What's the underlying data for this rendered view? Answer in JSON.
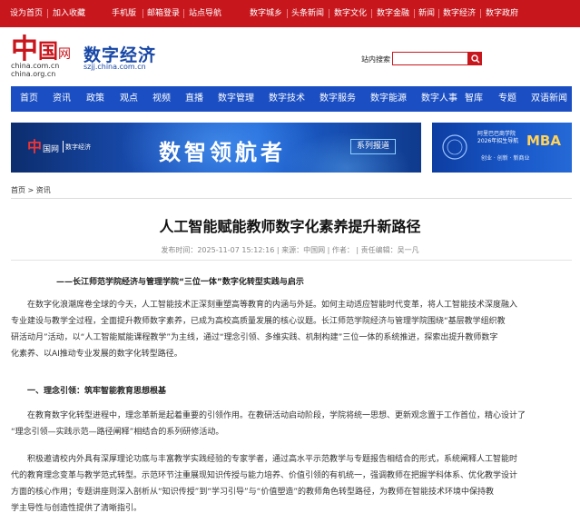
{
  "topbar": {
    "links": [
      "设为首页",
      "加入收藏",
      "手机版",
      "邮箱登录",
      "站点导航",
      "数字城乡",
      "头条新闻",
      "数字文化",
      "数字金融",
      "新闻",
      "数字经济",
      "数字政府"
    ]
  },
  "header": {
    "logo_text": "中国网",
    "logo_domain_1": "china.com.cn",
    "logo_domain_2": "china.org.cn",
    "channel_name": "数字经济",
    "channel_domain": "szjj.china.com.cn",
    "search_label": "站内搜索",
    "search_placeholder": ""
  },
  "nav": {
    "items": [
      "首页",
      "资讯",
      "政策",
      "观点",
      "视频",
      "直播",
      "数字管理",
      "数字技术",
      "数字服务",
      "数字能源",
      "数字人事",
      "智库",
      "专题",
      "双语新闻"
    ]
  },
  "banner_main": {
    "logo_text": "中国网 数字经济",
    "title": "数智领航者",
    "tag": "系列报道"
  },
  "banner_ad": {
    "line1": "阿里巴巴商学院",
    "line2": "2026年招生导航",
    "mba": "MBA",
    "line3": "创业 · 创新 · 新商业"
  },
  "breadcrumb": {
    "home": "首页",
    "sep": " > ",
    "current": "资讯"
  },
  "article": {
    "title": "人工智能赋能教师数字化素养提升新路径",
    "meta": "发布时间：2025-11-07 15:12:16 | 来源：中国网 | 作者： | 责任编辑：吴一凡",
    "subtitle": "——长江师范学院经济与管理学院“三位一体”数字化转型实践与启示",
    "para1_lines": [
      "在数字化浪潮席卷全球的今天，人工智能技术正深刻重塑高等教育的内涵与外延。如何主动适应智能时代变革，将人工智能技术深度融入",
      "专业建设与教学全过程，全面提升教师数字素养，已成为高校高质量发展的核心议题。长江师范学院经济与管理学院围绕“基层教学组织教",
      "研活动月”活动，以“人工智能赋能课程教学”为主线，通过“理念引领、多维实践、机制构建”三位一体的系统推进，探索出提升教师数字",
      "化素养、以AI推动专业发展的数字化转型路径。"
    ],
    "section1": "一、理念引领：筑牢智能教育思想根基",
    "para2_lines": [
      "在教育数字化转型进程中，理念革新是起着重要的引领作用。在教研活动启动阶段，学院将统一思想、更新观念置于工作首位，精心设计了",
      "“理念引领—实践示范—路径阐释”相结合的系列研修活动。"
    ],
    "para3_lines": [
      "积极邀请校内外具有深厚理论功底与丰富教学实践经验的专家学者，通过高水平示范教学与专题报告相结合的形式，系统阐释人工智能时",
      "代的教育理念变革与教学范式转型。示范环节注重展现知识传授与能力培养、价值引领的有机统一，强调教师在把握学科体系、优化教学设计",
      "方面的核心作用；专题讲座则深入剖析从“知识传授”到“学习引导”与“价值塑造”的教师角色转型路径，为教师在智能技术环境中保持教",
      "学主导性与创造性提供了清晰指引。"
    ]
  },
  "colors": {
    "brand_red": "#c8161d",
    "nav_blue": "#1a4ec2",
    "channel_blue": "#1747a6"
  }
}
